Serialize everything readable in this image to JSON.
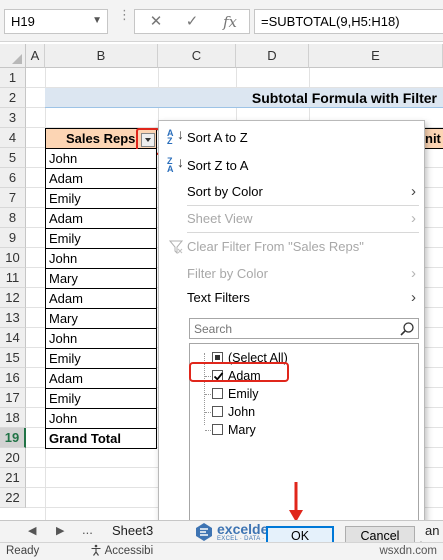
{
  "formula_bar": {
    "name_box": "H19",
    "cancel_glyph": "✕",
    "enter_glyph": "✓",
    "fx_glyph": "fx",
    "formula": "=SUBTOTAL(9,H5:H18)"
  },
  "columns": [
    "A",
    "B",
    "C",
    "D",
    "E"
  ],
  "rows": [
    "1",
    "2",
    "3",
    "4",
    "5",
    "6",
    "7",
    "8",
    "9",
    "10",
    "11",
    "12",
    "13",
    "14",
    "15",
    "16",
    "17",
    "18",
    "19",
    "20",
    "21",
    "22"
  ],
  "active_row": "19",
  "sheet": {
    "title": "Subtotal Formula with Filter",
    "header": "Sales Reps",
    "right_header_peek": "nit",
    "names": [
      "John",
      "Adam",
      "Emily",
      "Adam",
      "Emily",
      "John",
      "Mary",
      "Adam",
      "Mary",
      "John",
      "Emily",
      "Adam",
      "Emily",
      "John"
    ],
    "grand_total": "Grand Total"
  },
  "filter_menu": {
    "sort_az": "Sort A to Z",
    "sort_za": "Sort Z to A",
    "sort_by_color": "Sort by Color",
    "sheet_view": "Sheet View",
    "clear_filter": "Clear Filter From \"Sales Reps\"",
    "filter_by_color": "Filter by Color",
    "text_filters": "Text Filters",
    "search_placeholder": "Search",
    "items": [
      {
        "label": "(Select All)",
        "state": "partial"
      },
      {
        "label": "Adam",
        "state": "checked"
      },
      {
        "label": "Emily",
        "state": "unchecked"
      },
      {
        "label": "John",
        "state": "unchecked"
      },
      {
        "label": "Mary",
        "state": "unchecked"
      }
    ],
    "ok": "OK",
    "cancel": "Cancel"
  },
  "tabs": {
    "prev": "◀",
    "next": "▶",
    "more": "...",
    "sheet_name": "Sheet3",
    "right_peek": "an"
  },
  "status_bar": {
    "ready": "Ready",
    "accessibility": "Accessibi",
    "watermark": "wsxdn.com"
  },
  "logo": {
    "name": "exceldemy",
    "tagline": "EXCEL · DATA · BI"
  },
  "colors": {
    "header_fill": "#fcd5b4",
    "title_fill": "#dce6f1",
    "highlight_red": "#e0261b",
    "excel_green": "#217346",
    "ok_blue": "#0078d7"
  }
}
